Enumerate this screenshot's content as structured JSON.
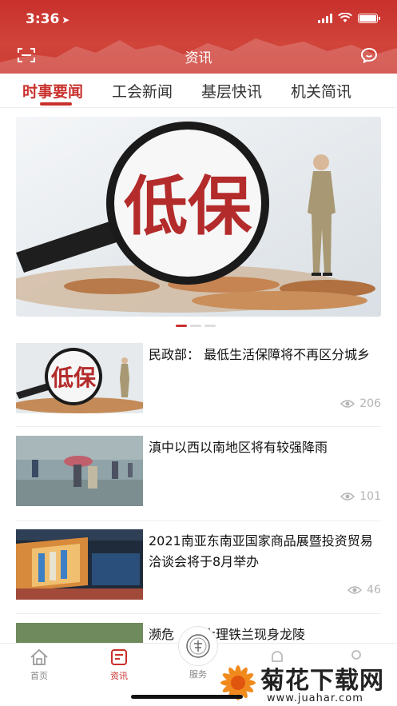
{
  "status_bar": {
    "time": "3:36"
  },
  "header": {
    "title": "资讯"
  },
  "tabs": [
    {
      "label": "时事要闻",
      "active": true
    },
    {
      "label": "工会新闻",
      "active": false
    },
    {
      "label": "基层快讯",
      "active": false
    },
    {
      "label": "机关简讯",
      "active": false
    }
  ],
  "banner": {
    "image_text": "低保",
    "slide_index": 1,
    "slide_count": 3
  },
  "news": [
    {
      "title": "民政部：  最低生活保障将不再区分城乡",
      "views": "206",
      "thumb_text": "低保"
    },
    {
      "title": "滇中以西以南地区将有较强降雨",
      "views": "101"
    },
    {
      "title": "2021南亚东南亚国家商品展暨投资贸易洽谈会将于8月举办",
      "views": "46"
    },
    {
      "title": "濒危",
      "views": ""
    }
  ],
  "partial_item_tail": "大理铁兰现身龙陵",
  "tabbar": [
    {
      "label": "首页",
      "icon": "home-icon",
      "active": false
    },
    {
      "label": "资讯",
      "icon": "news-icon",
      "active": true
    },
    {
      "label": "服务",
      "icon": "service-icon",
      "active": false
    },
    {
      "label": "",
      "icon": "bell-icon",
      "active": false
    },
    {
      "label": "",
      "icon": "profile-icon",
      "active": false
    }
  ],
  "watermark": {
    "text": "菊花下载网",
    "url": "www.juahar.com"
  },
  "colors": {
    "accent": "#c9302c",
    "muted": "#b5b5b5"
  }
}
